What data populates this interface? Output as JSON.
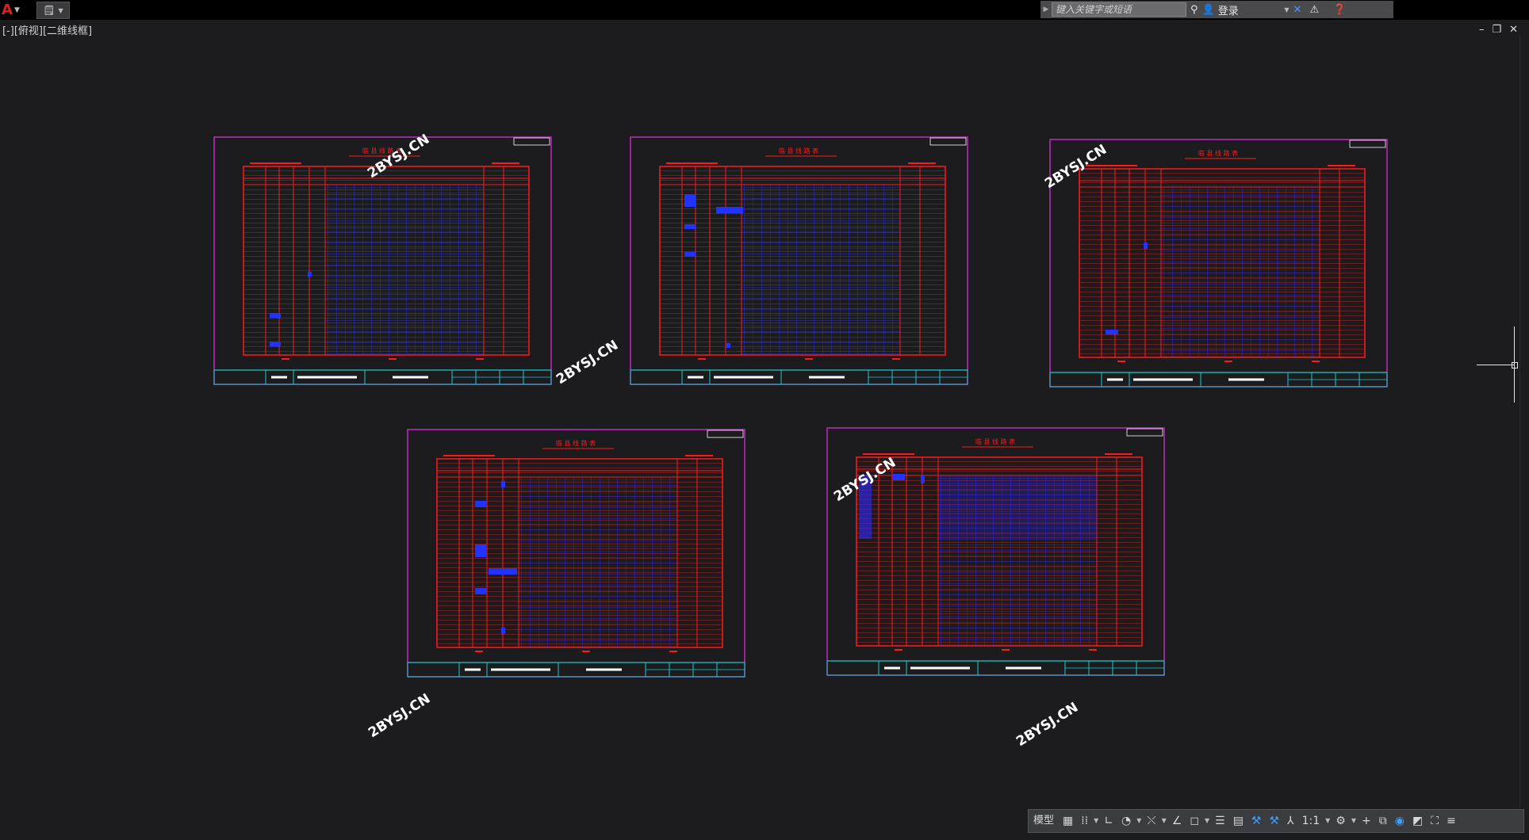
{
  "titlebar": {
    "search_placeholder": "键入关键字或短语",
    "login_label": "登录"
  },
  "viewport": {
    "label": "[-][俯视][二维线框]",
    "window_controls": [
      "–",
      "❐",
      "✕"
    ]
  },
  "drawing": {
    "sheets": [
      {
        "title": "临 县 线 路 表",
        "info_block": "设计项目 广东省宁某地区三级道路设计与施工图设计 线路设计表"
      },
      {
        "title": "临 县 线 路 表",
        "info_block": "设计项目 广东省宁某地区三级道路设计与施工图设计 线路设计表"
      },
      {
        "title": "临 县 线 路 表",
        "info_block": "设计项目 广东省宁某地区三级道路设计与施工图设计 线路设计表"
      },
      {
        "title": "临 县 线 路 表",
        "info_block": "设计项目 广东省宁某地区三级道路设计与施工图设计 线路设计表"
      },
      {
        "title": "临 县 线 路 表",
        "info_block": "设计项目 广东省宁某地区三级道路设计与施工图设计 线路设计表"
      }
    ],
    "watermark": "2BYSJ.CN",
    "colors": {
      "frame": "#c426c4",
      "table": "#ff1a1a",
      "fill": "#1a1aff",
      "title_block": "#1fc8c8"
    }
  },
  "statusbar": {
    "model_label": "模型",
    "scale": "1:1"
  }
}
